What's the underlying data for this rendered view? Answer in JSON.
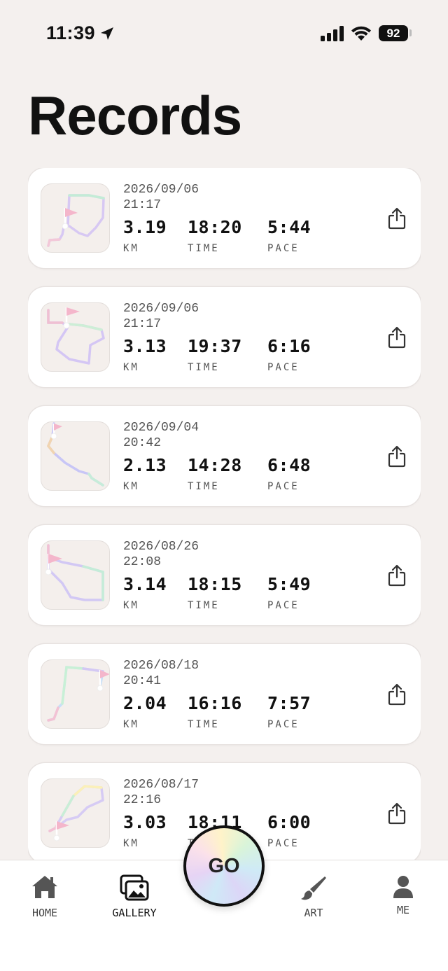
{
  "status_bar": {
    "time": "11:39",
    "battery": "92"
  },
  "page": {
    "title": "Records"
  },
  "labels": {
    "distance": "KM",
    "time": "TIME",
    "pace": "PACE"
  },
  "records": [
    {
      "date": "2026/09/06",
      "time_of_day": "21:17",
      "distance": "3.19",
      "duration": "18:20",
      "pace": "5:44"
    },
    {
      "date": "2026/09/06",
      "time_of_day": "21:17",
      "distance": "3.13",
      "duration": "19:37",
      "pace": "6:16"
    },
    {
      "date": "2026/09/04",
      "time_of_day": "20:42",
      "distance": "2.13",
      "duration": "14:28",
      "pace": "6:48"
    },
    {
      "date": "2026/08/26",
      "time_of_day": "22:08",
      "distance": "3.14",
      "duration": "18:15",
      "pace": "5:49"
    },
    {
      "date": "2026/08/18",
      "time_of_day": "20:41",
      "distance": "2.04",
      "duration": "16:16",
      "pace": "7:57"
    },
    {
      "date": "2026/08/17",
      "time_of_day": "22:16",
      "distance": "3.03",
      "duration": "18:11",
      "pace": "6:00"
    }
  ],
  "tabs": [
    {
      "label": "HOME",
      "icon": "home-icon"
    },
    {
      "label": "GALLERY",
      "icon": "gallery-icon"
    },
    {
      "label": "ART",
      "icon": "brush-icon"
    },
    {
      "label": "ME",
      "icon": "person-icon"
    }
  ],
  "go_button": {
    "label": "GO"
  }
}
